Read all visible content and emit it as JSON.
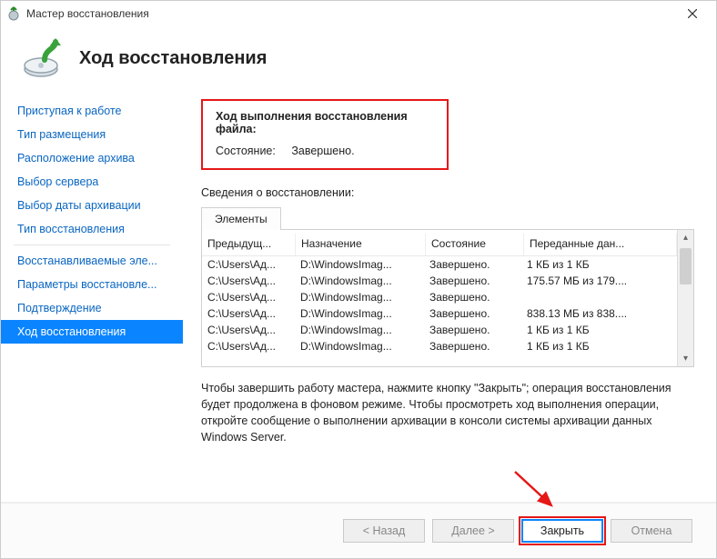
{
  "window": {
    "title": "Мастер восстановления"
  },
  "header": {
    "title": "Ход восстановления"
  },
  "sidebar": {
    "steps": [
      "Приступая к работе",
      "Тип размещения",
      "Расположение архива",
      "Выбор сервера",
      "Выбор даты архивации",
      "Тип восстановления",
      "Восстанавливаемые эле...",
      "Параметры восстановле...",
      "Подтверждение",
      "Ход восстановления"
    ],
    "separator_after_index": 5,
    "current_index": 9
  },
  "status": {
    "heading": "Ход выполнения восстановления файла:",
    "state_label": "Состояние:",
    "state_value": "Завершено."
  },
  "details_label": "Сведения о восстановлении:",
  "tab_label": "Элементы",
  "columns": [
    "Предыдущ...",
    "Назначение",
    "Состояние",
    "Переданные дан..."
  ],
  "rows": [
    [
      "C:\\Users\\Ад...",
      "D:\\WindowsImag...",
      "Завершено.",
      "1 КБ из 1 КБ"
    ],
    [
      "C:\\Users\\Ад...",
      "D:\\WindowsImag...",
      "Завершено.",
      "175.57 МБ из 179...."
    ],
    [
      "C:\\Users\\Ад...",
      "D:\\WindowsImag...",
      "Завершено.",
      ""
    ],
    [
      "C:\\Users\\Ад...",
      "D:\\WindowsImag...",
      "Завершено.",
      "838.13 МБ из 838...."
    ],
    [
      "C:\\Users\\Ад...",
      "D:\\WindowsImag...",
      "Завершено.",
      "1 КБ из 1 КБ"
    ],
    [
      "C:\\Users\\Ад...",
      "D:\\WindowsImag...",
      "Завершено.",
      "1 КБ из 1 КБ"
    ]
  ],
  "hint": "Чтобы завершить работу мастера, нажмите кнопку \"Закрыть\"; операция восстановления будет продолжена в фоновом режиме. Чтобы просмотреть ход выполнения операции, откройте сообщение о выполнении архивации в консоли системы архивации данных Windows Server.",
  "footer": {
    "back": "< Назад",
    "next": "Далее >",
    "close": "Закрыть",
    "cancel": "Отмена"
  }
}
